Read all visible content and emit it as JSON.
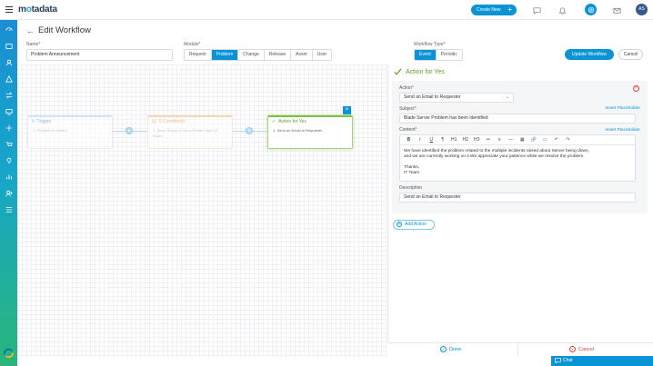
{
  "app": {
    "logo_prefix": "m",
    "logo_o": "o",
    "logo_suffix": "tadata"
  },
  "topbar": {
    "create_new": "Create New",
    "create_plus": "+",
    "avatar_initials": "AS"
  },
  "page": {
    "back": "←",
    "title": "Edit Workflow"
  },
  "form": {
    "name_label": "Name",
    "name_value": "Problem Announcement",
    "module_label": "Module",
    "modules": [
      "Request",
      "Problem",
      "Change",
      "Release",
      "Asset",
      "User"
    ],
    "module_selected": "Problem",
    "workflow_type_label": "Workflow Type",
    "workflow_types": [
      "Event",
      "Periodic"
    ],
    "workflow_type_selected": "Event",
    "required_mark": "*",
    "update_label": "Update Workflow",
    "cancel_label": "Cancel"
  },
  "canvas": {
    "trigger": {
      "title": "Trigger",
      "desc": "1. Problem is created"
    },
    "conditions": {
      "title": "0 Condition/s",
      "desc_line1": "1. Since Status is Open Greater than 10",
      "desc_line2": "Hours"
    },
    "action": {
      "title": "Action for Yes",
      "desc": "1. Send an Email to Requester"
    },
    "close": "×",
    "connector_plus": "+"
  },
  "panel": {
    "title": "Action for Yes",
    "remove": "×",
    "action_label": "Action",
    "action_value": "Send an Email to Requester",
    "subject_label": "Subject",
    "insert_placeholder": "Insert Placeholder",
    "subject_value": "Blade Server Problem has been Identified",
    "content_label": "Content",
    "toolbar": [
      "B",
      "I",
      "U",
      "¶",
      "H1",
      "H2",
      "H3",
      "≔",
      "≡",
      "—",
      "▦",
      "🔗",
      "▭",
      "↶",
      "↷"
    ],
    "content_lines": [
      "We have identified the problem related to the multiple incidents raised about Server being down,",
      "and we are currently working on it.We appreciate your patience while we resolve the problem.",
      "",
      "Thanks,",
      "IT Team"
    ],
    "description_label": "Description",
    "description_value": "Send an Email to Requester",
    "add_action": "Add Action",
    "add_plus": "+",
    "done": "Done",
    "cancel": "Cancel"
  },
  "chat": {
    "label": "Chat"
  },
  "colors": {
    "primary": "#0a94d6",
    "success": "#5a9f25",
    "warning": "#e58a2c",
    "danger": "#e0413e"
  }
}
